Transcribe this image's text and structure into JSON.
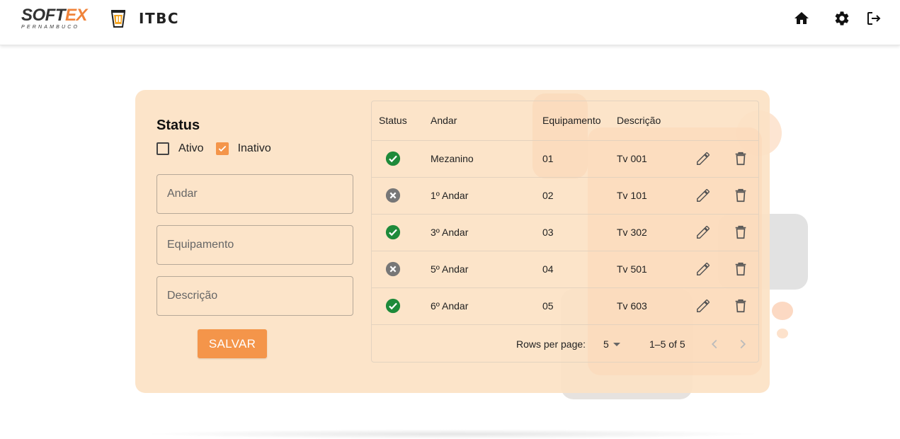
{
  "header": {
    "softex_logo": {
      "text_main": "SOFT",
      "text_accent": "EX",
      "subtitle": "PERNAMBUCO"
    },
    "itbc_logo": {
      "text": "ITBC"
    },
    "icons": [
      "home-icon",
      "gear-icon",
      "logout-icon"
    ]
  },
  "form": {
    "status_title": "Status",
    "checkboxes": [
      {
        "label": "Ativo",
        "checked": false
      },
      {
        "label": "Inativo",
        "checked": true
      }
    ],
    "fields": {
      "andar_placeholder": "Andar",
      "equipamento_placeholder": "Equipamento",
      "descricao_placeholder": "Descrição"
    },
    "save_label": "SALVAR"
  },
  "table": {
    "columns": [
      "Status",
      "Andar",
      "Equipamento",
      "Descrição"
    ],
    "rows": [
      {
        "status": "active",
        "andar": "Mezanino",
        "equipamento": "01",
        "descricao": "Tv 001"
      },
      {
        "status": "inactive",
        "andar": "1º Andar",
        "equipamento": "02",
        "descricao": "Tv 101"
      },
      {
        "status": "active",
        "andar": "3º Andar",
        "equipamento": "03",
        "descricao": "Tv 302"
      },
      {
        "status": "inactive",
        "andar": "5º Andar",
        "equipamento": "04",
        "descricao": "Tv 501"
      },
      {
        "status": "active",
        "andar": "6º Andar",
        "equipamento": "05",
        "descricao": "Tv 603"
      }
    ],
    "pagination": {
      "rows_per_page_label": "Rows per page:",
      "rows_per_page": "5",
      "range": "1–5 of 5"
    }
  },
  "colors": {
    "accent": "#f4954a",
    "card_bg": "#fce2c4",
    "status_active": "#1e8a3a",
    "status_inactive": "#777777"
  }
}
